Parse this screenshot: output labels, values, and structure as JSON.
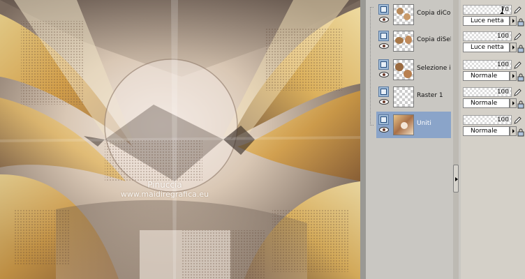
{
  "canvas": {
    "watermark_line1": "Pinuccia",
    "watermark_line2": "www.maidiregrafica.eu"
  },
  "layers": [
    {
      "name": "Copia diCopia",
      "opacity": "70",
      "blend_mode": "Luce netta",
      "selected": false,
      "thumb": "copy-of-copy"
    },
    {
      "name": "Copia diSelezione",
      "opacity": "100",
      "blend_mode": "Luce netta",
      "selected": false,
      "thumb": "copy-of-selection"
    },
    {
      "name": "Selezione innalzata",
      "opacity": "100",
      "blend_mode": "Normale",
      "selected": false,
      "thumb": "selection"
    },
    {
      "name": "Raster 1",
      "opacity": "100",
      "blend_mode": "Normale",
      "selected": false,
      "thumb": "transparent"
    },
    {
      "name": "Uniti",
      "opacity": "100",
      "blend_mode": "Normale",
      "selected": true,
      "thumb": "merged"
    }
  ],
  "icons": {
    "layer_type": "raster-layer-icon",
    "visibility": "eye-icon",
    "edit": "pencil-icon",
    "lock": "lock-icon"
  },
  "colors": {
    "selected_row": "#8aa4c9",
    "panel_bg": "#c9c7c2",
    "canvas_gold": "#d9a94a"
  }
}
